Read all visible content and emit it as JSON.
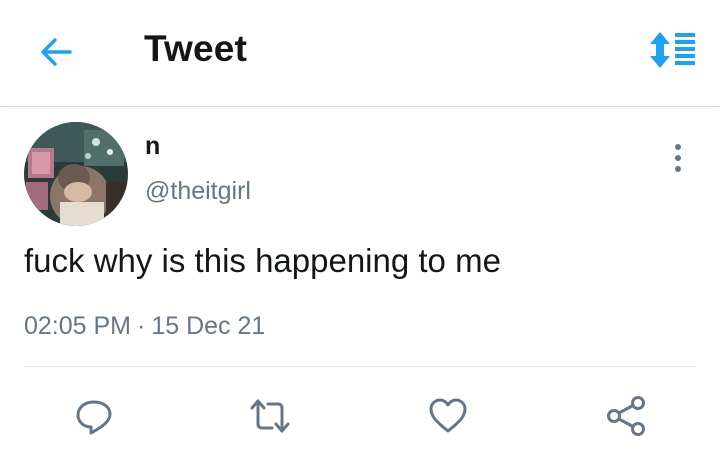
{
  "header": {
    "title": "Tweet",
    "back_icon": "arrow-left-icon",
    "sort_icon": "sort-list-icon",
    "accent_color": "#1da1f2"
  },
  "tweet": {
    "author_name": "n",
    "author_handle": "@theitgirl",
    "text": "fuck why is this happening to me",
    "time": "02:05 PM",
    "separator": "·",
    "date": "15 Dec 21",
    "more_icon": "more-vertical-icon"
  },
  "actions": [
    {
      "name": "reply",
      "icon": "reply-icon"
    },
    {
      "name": "retweet",
      "icon": "retweet-icon"
    },
    {
      "name": "like",
      "icon": "heart-icon"
    },
    {
      "name": "share",
      "icon": "share-icon"
    }
  ],
  "colors": {
    "text_primary": "#14171a",
    "text_secondary": "#657786",
    "icon_gray": "#657786",
    "divider": "#e1e8ed"
  }
}
